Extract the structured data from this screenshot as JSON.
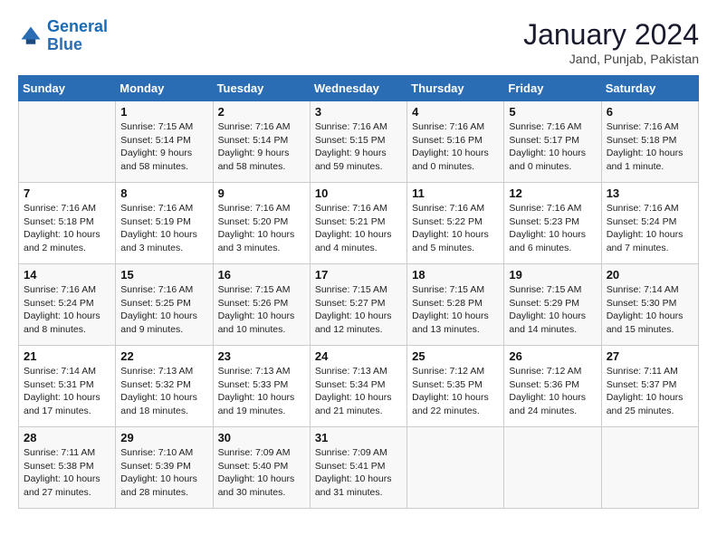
{
  "header": {
    "logo_line1": "General",
    "logo_line2": "Blue",
    "month": "January 2024",
    "location": "Jand, Punjab, Pakistan"
  },
  "weekdays": [
    "Sunday",
    "Monday",
    "Tuesday",
    "Wednesday",
    "Thursday",
    "Friday",
    "Saturday"
  ],
  "weeks": [
    [
      {
        "day": "",
        "info": ""
      },
      {
        "day": "1",
        "info": "Sunrise: 7:15 AM\nSunset: 5:14 PM\nDaylight: 9 hours\nand 58 minutes."
      },
      {
        "day": "2",
        "info": "Sunrise: 7:16 AM\nSunset: 5:14 PM\nDaylight: 9 hours\nand 58 minutes."
      },
      {
        "day": "3",
        "info": "Sunrise: 7:16 AM\nSunset: 5:15 PM\nDaylight: 9 hours\nand 59 minutes."
      },
      {
        "day": "4",
        "info": "Sunrise: 7:16 AM\nSunset: 5:16 PM\nDaylight: 10 hours\nand 0 minutes."
      },
      {
        "day": "5",
        "info": "Sunrise: 7:16 AM\nSunset: 5:17 PM\nDaylight: 10 hours\nand 0 minutes."
      },
      {
        "day": "6",
        "info": "Sunrise: 7:16 AM\nSunset: 5:18 PM\nDaylight: 10 hours\nand 1 minute."
      }
    ],
    [
      {
        "day": "7",
        "info": "Sunrise: 7:16 AM\nSunset: 5:18 PM\nDaylight: 10 hours\nand 2 minutes."
      },
      {
        "day": "8",
        "info": "Sunrise: 7:16 AM\nSunset: 5:19 PM\nDaylight: 10 hours\nand 3 minutes."
      },
      {
        "day": "9",
        "info": "Sunrise: 7:16 AM\nSunset: 5:20 PM\nDaylight: 10 hours\nand 3 minutes."
      },
      {
        "day": "10",
        "info": "Sunrise: 7:16 AM\nSunset: 5:21 PM\nDaylight: 10 hours\nand 4 minutes."
      },
      {
        "day": "11",
        "info": "Sunrise: 7:16 AM\nSunset: 5:22 PM\nDaylight: 10 hours\nand 5 minutes."
      },
      {
        "day": "12",
        "info": "Sunrise: 7:16 AM\nSunset: 5:23 PM\nDaylight: 10 hours\nand 6 minutes."
      },
      {
        "day": "13",
        "info": "Sunrise: 7:16 AM\nSunset: 5:24 PM\nDaylight: 10 hours\nand 7 minutes."
      }
    ],
    [
      {
        "day": "14",
        "info": "Sunrise: 7:16 AM\nSunset: 5:24 PM\nDaylight: 10 hours\nand 8 minutes."
      },
      {
        "day": "15",
        "info": "Sunrise: 7:16 AM\nSunset: 5:25 PM\nDaylight: 10 hours\nand 9 minutes."
      },
      {
        "day": "16",
        "info": "Sunrise: 7:15 AM\nSunset: 5:26 PM\nDaylight: 10 hours\nand 10 minutes."
      },
      {
        "day": "17",
        "info": "Sunrise: 7:15 AM\nSunset: 5:27 PM\nDaylight: 10 hours\nand 12 minutes."
      },
      {
        "day": "18",
        "info": "Sunrise: 7:15 AM\nSunset: 5:28 PM\nDaylight: 10 hours\nand 13 minutes."
      },
      {
        "day": "19",
        "info": "Sunrise: 7:15 AM\nSunset: 5:29 PM\nDaylight: 10 hours\nand 14 minutes."
      },
      {
        "day": "20",
        "info": "Sunrise: 7:14 AM\nSunset: 5:30 PM\nDaylight: 10 hours\nand 15 minutes."
      }
    ],
    [
      {
        "day": "21",
        "info": "Sunrise: 7:14 AM\nSunset: 5:31 PM\nDaylight: 10 hours\nand 17 minutes."
      },
      {
        "day": "22",
        "info": "Sunrise: 7:13 AM\nSunset: 5:32 PM\nDaylight: 10 hours\nand 18 minutes."
      },
      {
        "day": "23",
        "info": "Sunrise: 7:13 AM\nSunset: 5:33 PM\nDaylight: 10 hours\nand 19 minutes."
      },
      {
        "day": "24",
        "info": "Sunrise: 7:13 AM\nSunset: 5:34 PM\nDaylight: 10 hours\nand 21 minutes."
      },
      {
        "day": "25",
        "info": "Sunrise: 7:12 AM\nSunset: 5:35 PM\nDaylight: 10 hours\nand 22 minutes."
      },
      {
        "day": "26",
        "info": "Sunrise: 7:12 AM\nSunset: 5:36 PM\nDaylight: 10 hours\nand 24 minutes."
      },
      {
        "day": "27",
        "info": "Sunrise: 7:11 AM\nSunset: 5:37 PM\nDaylight: 10 hours\nand 25 minutes."
      }
    ],
    [
      {
        "day": "28",
        "info": "Sunrise: 7:11 AM\nSunset: 5:38 PM\nDaylight: 10 hours\nand 27 minutes."
      },
      {
        "day": "29",
        "info": "Sunrise: 7:10 AM\nSunset: 5:39 PM\nDaylight: 10 hours\nand 28 minutes."
      },
      {
        "day": "30",
        "info": "Sunrise: 7:09 AM\nSunset: 5:40 PM\nDaylight: 10 hours\nand 30 minutes."
      },
      {
        "day": "31",
        "info": "Sunrise: 7:09 AM\nSunset: 5:41 PM\nDaylight: 10 hours\nand 31 minutes."
      },
      {
        "day": "",
        "info": ""
      },
      {
        "day": "",
        "info": ""
      },
      {
        "day": "",
        "info": ""
      }
    ]
  ]
}
